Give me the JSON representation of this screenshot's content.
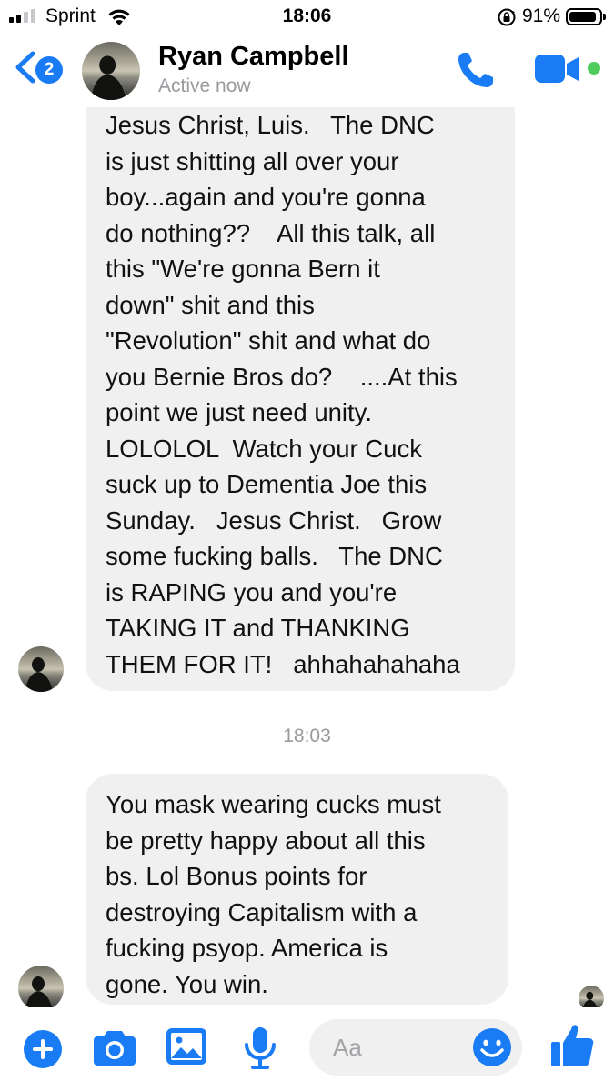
{
  "status_bar": {
    "carrier": "Sprint",
    "time": "18:06",
    "battery_percent": "91%",
    "battery_level": 0.91,
    "icons": [
      "signal-icon",
      "wifi-icon",
      "rotation-lock-icon",
      "battery-icon"
    ]
  },
  "header": {
    "back_badge": "2",
    "contact_name": "Ryan Campbell",
    "contact_status": "Active now",
    "icons": [
      "back-chevron-icon",
      "phone-icon",
      "video-camera-icon"
    ]
  },
  "conversation": {
    "messages": [
      {
        "text": "Jesus Christ, Luis.   The DNC\nis just shitting all over your\nboy...again and you're gonna\ndo nothing??    All this talk, all\nthis \"We're gonna Bern it\ndown\" shit and this\n\"Revolution\" shit and what do\nyou Bernie Bros do?    ....At this\npoint we just need unity.\nLOLOLOL  Watch your Cuck\nsuck up to Dementia Joe this\nSunday.   Jesus Christ.   Grow\nsome fucking balls.   The DNC\nis RAPING you and you're\nTAKING IT and THANKING\nTHEM FOR IT!   ahhahahahaha"
      },
      {
        "text": "You mask wearing cucks must\nbe pretty happy about all this\nbs. Lol Bonus points for\ndestroying Capitalism with a\nfucking psyop. America is\ngone. You win."
      }
    ],
    "timestamp": "18:03"
  },
  "composer": {
    "placeholder": "Aa",
    "icons": [
      "plus-icon",
      "camera-icon",
      "image-icon",
      "microphone-icon",
      "emoji-icon",
      "thumbs-up-icon"
    ]
  },
  "colors": {
    "accent": "#1a7cf5",
    "bubble": "#f0f0f0",
    "online": "#4ecd5d",
    "muted_text": "#9a9a9e"
  }
}
